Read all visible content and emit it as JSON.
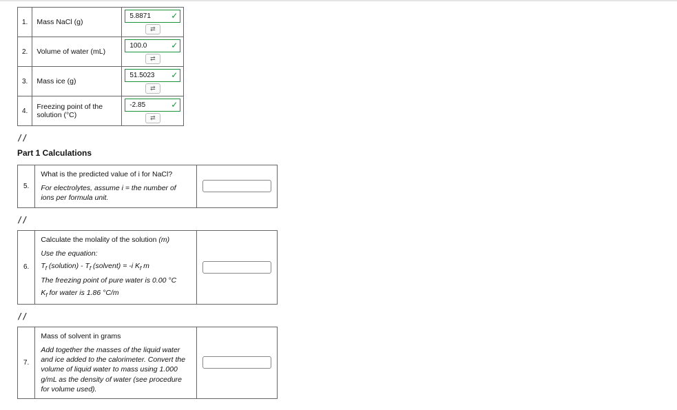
{
  "rows": [
    {
      "n": "1.",
      "label": "Mass NaCl (g)",
      "value": "5.8871"
    },
    {
      "n": "2.",
      "label": "Volume of water (mL)",
      "value": "100.0"
    },
    {
      "n": "3.",
      "label": "Mass ice (g)",
      "value": "51.5023"
    },
    {
      "n": "4.",
      "label": "Freezing point of the solution (°C)",
      "value": "-2.85"
    }
  ],
  "sep": "//",
  "section": "Part 1 Calculations",
  "q5": {
    "n": "5.",
    "line1": "What is the predicted value of i for NaCl?",
    "line2": "For electrolytes, assume i = the number of ions per formula unit."
  },
  "q6": {
    "n": "6.",
    "line1": "Calculate the molality of the solution (m)",
    "hintA": "Use the equation:",
    "eq": "T_f (solution) - T_f (solvent) = -i K_f m",
    "hintB": "The freezing point of pure water is 0.00 °C",
    "hintC": "K_f for water is 1.86 °C/m"
  },
  "q7": {
    "n": "7.",
    "line1": "Mass of solvent in grams",
    "line2": "Add together the masses of the liquid water and ice added to the calorimeter. Convert the volume of liquid water to mass using 1.000 g/mL as the density of water (see procedure for volume used)."
  },
  "retry_icon": "⇄"
}
